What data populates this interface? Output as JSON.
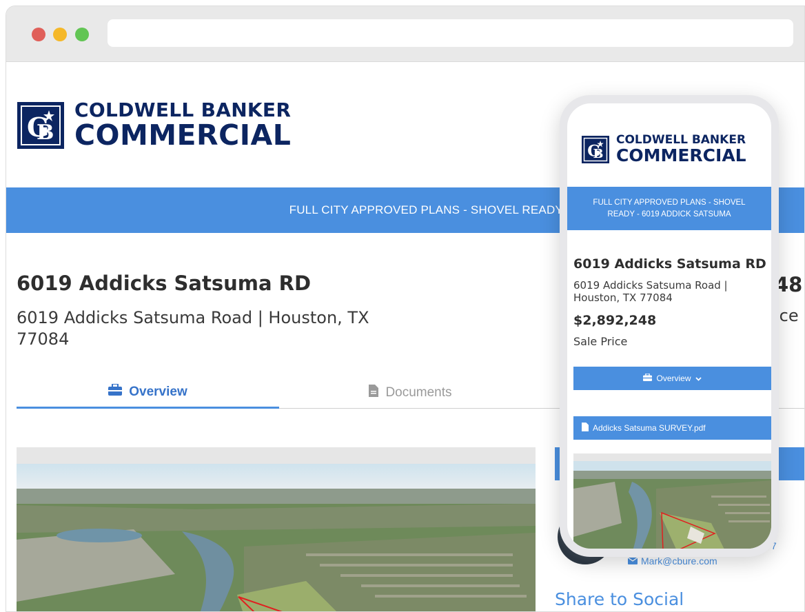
{
  "brand": {
    "line1": "COLDWELL BANKER",
    "line2": "COMMERCIAL",
    "color": "#0c2561"
  },
  "accent_color": "#4a8fdf",
  "desktop": {
    "banner": "FULL CITY APPROVED PLANS - SHOVEL READY - 6019 ADDI",
    "title": "6019 Addicks Satsuma RD",
    "address": "6019 Addicks Satsuma Road | Houston, TX 77084",
    "price_fragment": "48",
    "price_label_fragment": "ice",
    "tabs": [
      {
        "label": "Overview",
        "icon": "briefcase-icon",
        "active": true
      },
      {
        "label": "Documents",
        "icon": "file-icon",
        "active": false
      }
    ],
    "contact": {
      "email": "Mark@cbure.com",
      "phone_fragment": "7"
    },
    "share_heading": "Share to Social"
  },
  "mobile": {
    "banner": "FULL CITY APPROVED PLANS - SHOVEL READY - 6019 ADDICK SATSUMA",
    "title": "6019 Addicks Satsuma RD",
    "address": "6019 Addicks Satsuma Road | Houston, TX 77084",
    "price": "$2,892,248",
    "price_label": "Sale Price",
    "overview_button": "Overview",
    "document": "Addicks Satsuma SURVEY.pdf"
  }
}
